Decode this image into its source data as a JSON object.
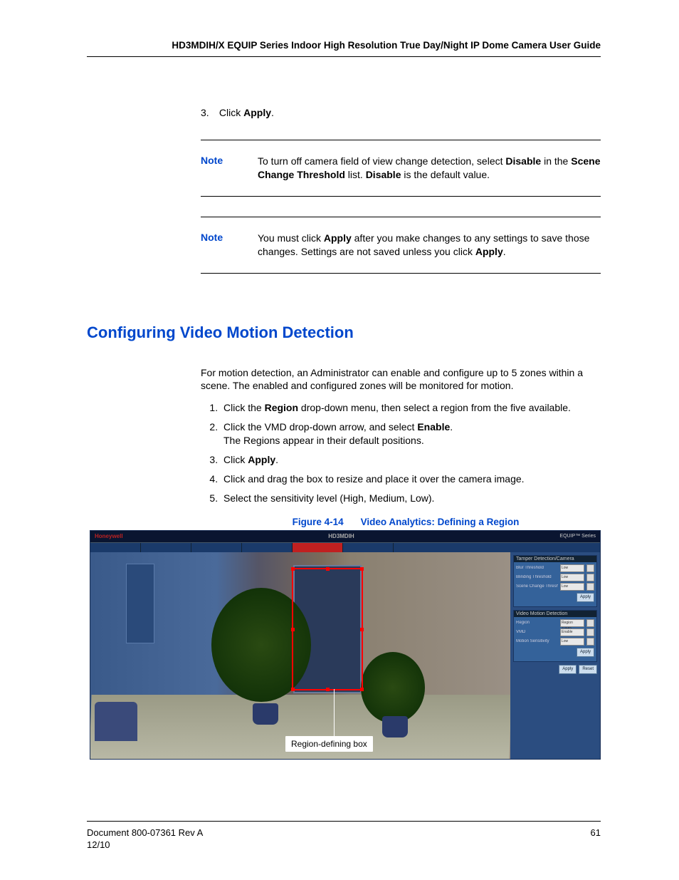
{
  "header": "HD3MDIH/X EQUIP Series Indoor High Resolution True Day/Night IP Dome Camera User Guide",
  "step3_prefix": "3.",
  "step3_text_a": "Click ",
  "step3_text_b": "Apply",
  "step3_text_c": ".",
  "note1": {
    "label": "Note",
    "t1": "To turn off camera field of view change detection, select ",
    "b1": "Disable",
    "t2": " in the ",
    "b2": "Scene Change Threshold",
    "t3": " list. ",
    "b3": "Disable",
    "t4": " is the default value."
  },
  "note2": {
    "label": "Note",
    "t1": "You must click ",
    "b1": "Apply",
    "t2": " after you make changes to any settings to save those changes. Settings are not saved unless you click ",
    "b2": "Apply",
    "t3": "."
  },
  "section_title": "Configuring Video Motion Detection",
  "intro": "For motion detection, an Administrator can enable and configure up to 5 zones within a scene. The enabled and configured zones will be monitored for motion.",
  "steps": {
    "s1a": "Click the ",
    "s1b": "Region",
    "s1c": " drop-down menu, then select a region from the five available.",
    "s2a": "Click the VMD drop-down arrow, and select ",
    "s2b": "Enable",
    "s2c": ".",
    "s2d": "The Regions appear in their default positions.",
    "s3a": "Click ",
    "s3b": "Apply",
    "s3c": ".",
    "s4": "Click and drag the box to resize and place it over the camera image.",
    "s5": "Select the sensitivity level (High, Medium, Low)."
  },
  "figure": {
    "number": "Figure 4-14",
    "title": "Video Analytics: Defining a Region",
    "brand": "Honeywell",
    "model": "HD3MDIH",
    "series": "EQUIP™ Series",
    "callout": "Region-defining box",
    "panel1_header": "Tamper Detection/Camera",
    "panel2_header": "Video Motion Detection",
    "rows1": [
      "Blur Threshold",
      "Blinding Threshold",
      "Scene Change Threshold"
    ],
    "rows2": [
      "Region",
      "VMD",
      "Motion Sensitivity"
    ],
    "field_vals1": [
      "Low",
      "Low",
      "Low"
    ],
    "field_vals2": [
      "Region 1VMD",
      "Enable",
      "Low"
    ],
    "btn_apply": "Apply",
    "btn_reset": "Reset"
  },
  "footer": {
    "doc": "Document 800-07361 Rev A",
    "date": "12/10",
    "pagenum": "61"
  }
}
